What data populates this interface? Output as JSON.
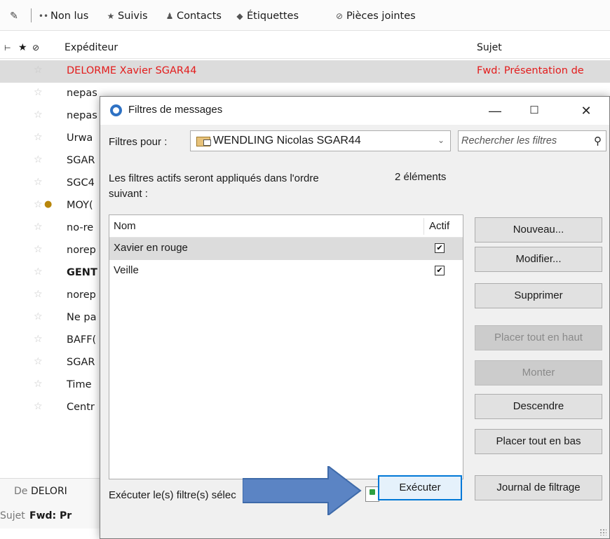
{
  "quickfilter": {
    "unread": "Non lus",
    "starred": "Suivis",
    "contacts": "Contacts",
    "tags": "Étiquettes",
    "attachments": "Pièces jointes"
  },
  "columns": {
    "sender": "Expéditeur",
    "subject": "Sujet"
  },
  "messages": [
    {
      "sender": "DELORME Xavier SGAR44",
      "subject": "Fwd: Présentation de"
    },
    {
      "sender": "nepas",
      "subject": ""
    },
    {
      "sender": "nepas",
      "subject": ""
    },
    {
      "sender": "Urwa",
      "subject": ""
    },
    {
      "sender": "SGAR",
      "subject": ""
    },
    {
      "sender": "SGC4",
      "subject": ""
    },
    {
      "sender": "MOY(",
      "subject": ""
    },
    {
      "sender": "no-re",
      "subject": ""
    },
    {
      "sender": "norep",
      "subject": ""
    },
    {
      "sender": "GENT",
      "subject": ""
    },
    {
      "sender": "norep",
      "subject": ""
    },
    {
      "sender": "Ne pa",
      "subject": ""
    },
    {
      "sender": "BAFF(",
      "subject": ""
    },
    {
      "sender": "SGAR",
      "subject": ""
    },
    {
      "sender": "Time",
      "subject": ""
    },
    {
      "sender": "Centr",
      "subject": ""
    }
  ],
  "preview": {
    "from_label": "De",
    "from_value": "DELORI",
    "subject_label": "Sujet",
    "subject_value": "Fwd: Pr"
  },
  "dialog": {
    "title": "Filtres de messages",
    "filters_for_label": "Filtres pour :",
    "account": "WENDLING Nicolas SGAR44",
    "search_placeholder": "Rechercher les filtres",
    "order_text": "Les filtres actifs seront appliqués dans l'ordre suivant :",
    "count_text": "2 éléments",
    "list_header_name": "Nom",
    "list_header_active": "Actif",
    "filters": [
      {
        "name": "Xavier en rouge",
        "active": true
      },
      {
        "name": "Veille",
        "active": true
      }
    ],
    "buttons": {
      "new": "Nouveau...",
      "edit": "Modifier...",
      "delete": "Supprimer",
      "move_top": "Placer tout en haut",
      "move_up": "Monter",
      "move_down": "Descendre",
      "move_bottom": "Placer tout en bas",
      "run": "Exécuter",
      "log": "Journal de filtrage"
    },
    "run_label": "Exécuter le(s) filtre(s) sélec"
  }
}
